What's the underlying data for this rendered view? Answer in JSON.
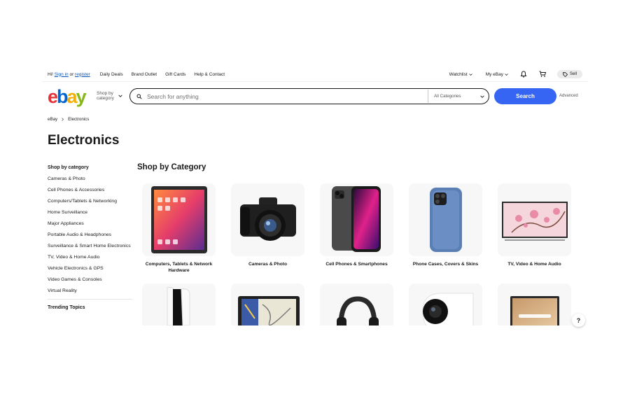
{
  "topbar": {
    "greeting_prefix": "Hi!",
    "sign_in": "Sign in",
    "or": "or",
    "register": "register",
    "links": [
      "Daily Deals",
      "Brand Outlet",
      "Gift Cards",
      "Help & Contact"
    ],
    "watchlist": "Watchlist",
    "my_ebay": "My eBay",
    "sell": "Sell"
  },
  "header": {
    "logo": {
      "e": "e",
      "b": "b",
      "a": "a",
      "y": "y"
    },
    "shop_by_category": "Shop by category",
    "search_placeholder": "Search for anything",
    "category_select": "All Categories",
    "search_button": "Search",
    "advanced": "Advanced"
  },
  "breadcrumb": {
    "home": "eBay",
    "current": "Electronics"
  },
  "page_title": "Electronics",
  "sidebar": {
    "heading": "Shop by category",
    "items": [
      "Cameras & Photo",
      "Cell Phones & Accessories",
      "Computers/Tablets & Networking",
      "Home Surveillance",
      "Major Appliances",
      "Portable Audio & Headphones",
      "Surveillance & Smart Home Electronics",
      "TV, Video & Home Audio",
      "Vehicle Electronics & GPS",
      "Video Games & Consoles",
      "Virtual Reality"
    ],
    "trending": "Trending Topics"
  },
  "main": {
    "title": "Shop by Category",
    "cards": [
      {
        "label": "Computers, Tablets & Network Hardware",
        "icon": "tablet-image"
      },
      {
        "label": "Cameras & Photo",
        "icon": "camera-image"
      },
      {
        "label": "Cell Phones & Smartphones",
        "icon": "smartphone-image"
      },
      {
        "label": "Phone Cases, Covers & Skins",
        "icon": "phone-case-image"
      },
      {
        "label": "TV, Video & Home Audio",
        "icon": "tv-image"
      },
      {
        "label": "",
        "icon": "game-console-image"
      },
      {
        "label": "",
        "icon": "gps-unit-image"
      },
      {
        "label": "",
        "icon": "headphones-image"
      },
      {
        "label": "",
        "icon": "security-camera-image"
      },
      {
        "label": "",
        "icon": "laptop-image"
      }
    ]
  },
  "help": "?",
  "colors": {
    "search_button": "#3665f3",
    "link": "#0654ba",
    "card_bg": "#f7f7f7"
  }
}
